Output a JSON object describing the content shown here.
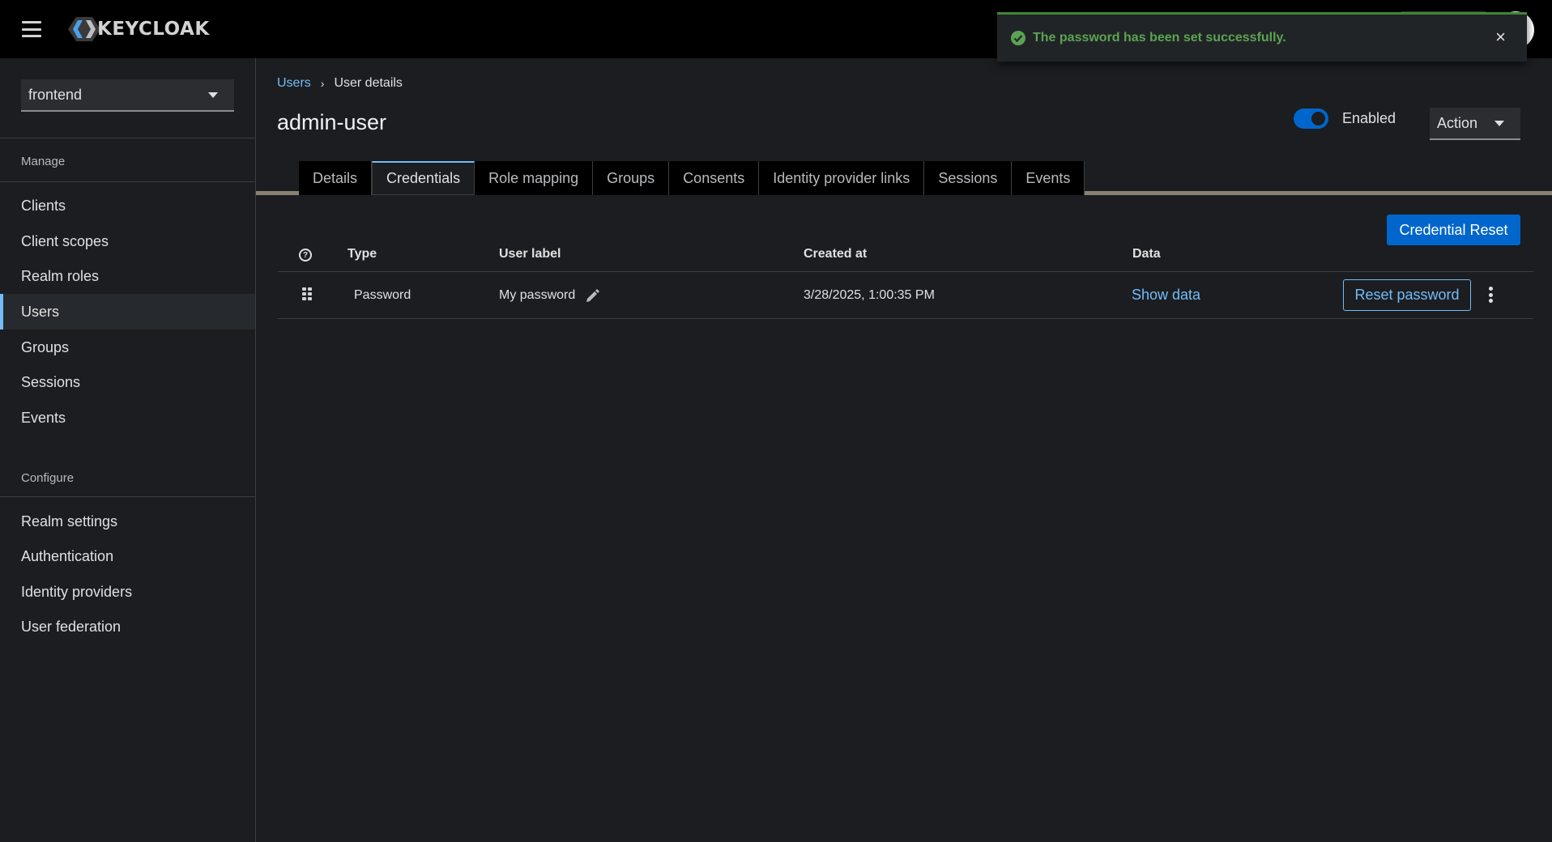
{
  "masthead": {
    "brand": "KEYCLOAK"
  },
  "toast": {
    "message": "The password has been set successfully.",
    "close_label": "×",
    "status_color": "#3e8635"
  },
  "sidebar": {
    "realm": "frontend",
    "sections": [
      {
        "title": "Manage",
        "items": [
          "Clients",
          "Client scopes",
          "Realm roles",
          "Users",
          "Groups",
          "Sessions",
          "Events"
        ]
      },
      {
        "title": "Configure",
        "items": [
          "Realm settings",
          "Authentication",
          "Identity providers",
          "User federation"
        ]
      }
    ],
    "active_item": "Users"
  },
  "breadcrumb": {
    "parent": "Users",
    "separator": "›",
    "current": "User details"
  },
  "page": {
    "title": "admin-user",
    "enabled_label": "Enabled",
    "enabled": true,
    "action_label": "Action"
  },
  "tabs": [
    "Details",
    "Credentials",
    "Role mapping",
    "Groups",
    "Consents",
    "Identity provider links",
    "Sessions",
    "Events"
  ],
  "active_tab": "Credentials",
  "credentials": {
    "reset_button": "Credential Reset",
    "help_glyph": "?",
    "columns": {
      "type": "Type",
      "user_label": "User label",
      "created_at": "Created at",
      "data": "Data"
    },
    "rows": [
      {
        "type": "Password",
        "user_label": "My password",
        "created_at": "3/28/2025, 1:00:35 PM",
        "data_link": "Show data",
        "action": "Reset password"
      }
    ]
  },
  "colors": {
    "accent": "#0066cc",
    "link": "#73bcf7",
    "success": "#3e8635",
    "background": "#1b1d21"
  }
}
